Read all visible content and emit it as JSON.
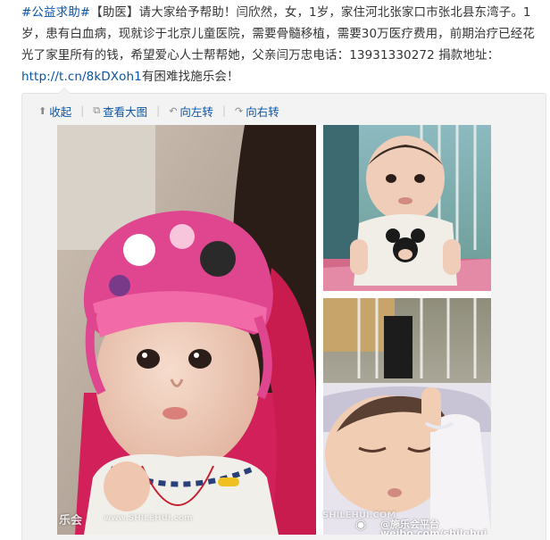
{
  "post": {
    "hashtag": "#公益求助#",
    "bracket_tag": "【助医】",
    "body_1": "请大家给予帮助！闫欣然，女，1岁，家住河北张家口市张北县东湾子。1岁，患有白血病，现就诊于北京儿童医院，需要骨髓移植，需要30万医疗费用，前期治疗已经花光了家里所有的钱，希望爱心人士帮帮她，父亲闫万忠电话：13931330272 捐款地址：",
    "link": "http://t.cn/8kDXoh1",
    "body_2": "有困难找施乐会！"
  },
  "toolbar": {
    "collapse": "收起",
    "view_large": "查看大图",
    "rotate_left": "向左转",
    "rotate_right": "向右转",
    "collapse_icon": "arrow-up-icon",
    "view_large_icon": "external-image-icon",
    "rotate_left_icon": "rotate-left-icon",
    "rotate_right_icon": "rotate-right-icon"
  },
  "photo": {
    "watermark_left": "乐会",
    "watermark_left_url": "www.SHILEHUI.com",
    "watermark_mid": "SHILEHUI.COM",
    "watermark_platform": "@施乐会平台",
    "watermark_url": "weibo.com/shilehui"
  },
  "colors": {
    "link": "#0a56a8",
    "hashtag": "#0a56a8",
    "card_bg": "#f3f3f3"
  }
}
